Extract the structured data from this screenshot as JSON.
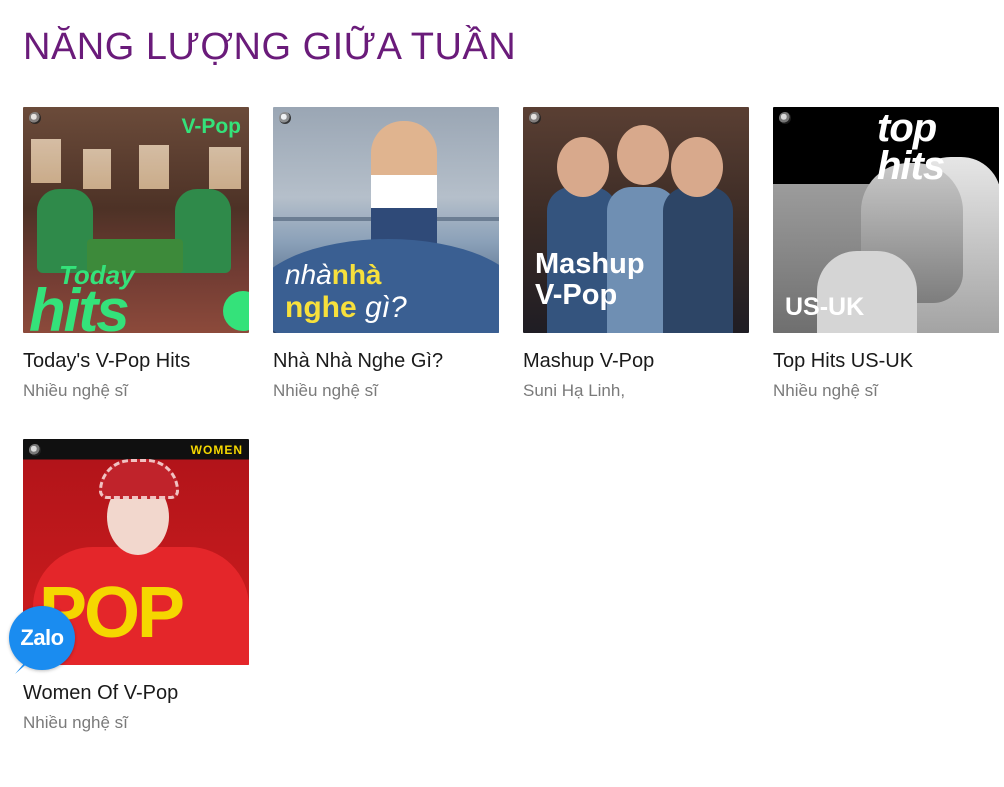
{
  "section": {
    "title": "NĂNG LƯỢNG GIỮA TUẦN"
  },
  "playlists": [
    {
      "title": "Today's V-Pop Hits",
      "subtitle": "Nhiều nghệ sĩ",
      "cover": {
        "tag": "V-Pop",
        "line1": "Today",
        "line2": "hits",
        "accent": "#34e27a"
      }
    },
    {
      "title": "Nhà Nhà Nghe Gì?",
      "subtitle": "Nhiều nghệ sĩ",
      "cover": {
        "word1": "nhà",
        "word2": "nhà",
        "word3": "nghe",
        "word4": "gì?",
        "accent": "#f7e03c"
      }
    },
    {
      "title": "Mashup V-Pop",
      "subtitle": "Suni Hạ Linh,",
      "cover": {
        "line1": "Mashup",
        "line2": "V-Pop"
      }
    },
    {
      "title": "Top Hits US-UK",
      "subtitle": "Nhiều nghệ sĩ",
      "cover": {
        "line1": "top",
        "line2": "hits",
        "tag": "US-UK"
      }
    },
    {
      "title": "Women Of V-Pop",
      "subtitle": "Nhiều nghệ sĩ",
      "cover": {
        "tag": "WOMEN",
        "big": "POP",
        "accent": "#f5d700"
      }
    }
  ],
  "zalo": {
    "label": "Zalo",
    "color": "#1a8cf0"
  },
  "colors": {
    "title": "#6a1b7a",
    "subtitle": "#7a7a7a"
  }
}
